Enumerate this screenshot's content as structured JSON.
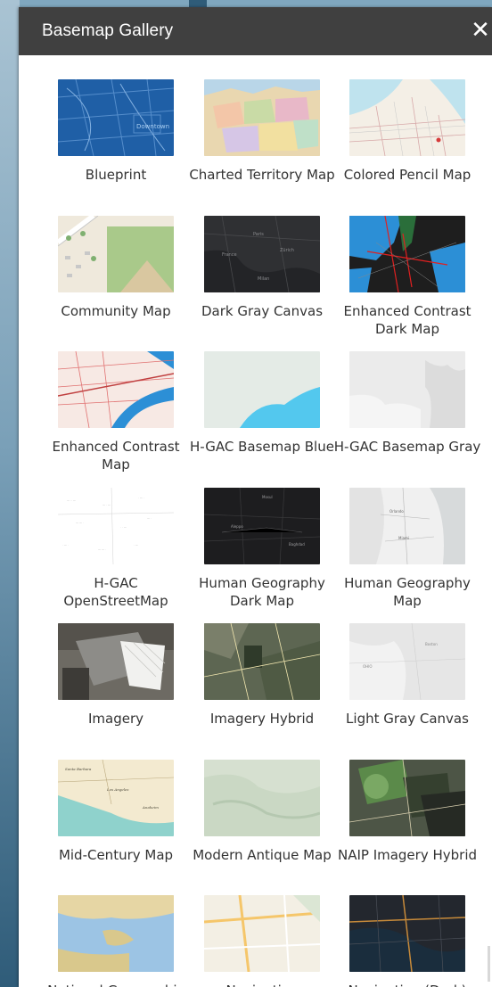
{
  "header": {
    "title": "Basemap Gallery",
    "close_symbol": "✕"
  },
  "items": [
    {
      "label": "Blueprint",
      "thumb": "blueprint"
    },
    {
      "label": "Charted Territory Map",
      "thumb": "charted"
    },
    {
      "label": "Colored Pencil Map",
      "thumb": "pencil"
    },
    {
      "label": "Community Map",
      "thumb": "community"
    },
    {
      "label": "Dark Gray Canvas",
      "thumb": "darkgray"
    },
    {
      "label": "Enhanced Contrast Dark Map",
      "thumb": "ecdark"
    },
    {
      "label": "Enhanced Contrast Map",
      "thumb": "ecmap"
    },
    {
      "label": "H-GAC Basemap Blue",
      "thumb": "hgacblue"
    },
    {
      "label": "H-GAC Basemap Gray",
      "thumb": "hgacgray"
    },
    {
      "label": "H-GAC OpenStreetMap Reference",
      "thumb": "hgacosm"
    },
    {
      "label": "Human Geography Dark Map",
      "thumb": "humandark"
    },
    {
      "label": "Human Geography Map",
      "thumb": "humanmap"
    },
    {
      "label": "Imagery",
      "thumb": "imagery"
    },
    {
      "label": "Imagery Hybrid",
      "thumb": "imageryhybrid"
    },
    {
      "label": "Light Gray Canvas",
      "thumb": "lightgray"
    },
    {
      "label": "Mid-Century Map",
      "thumb": "midcentury"
    },
    {
      "label": "Modern Antique Map",
      "thumb": "antique"
    },
    {
      "label": "NAIP Imagery Hybrid",
      "thumb": "naip"
    },
    {
      "label": "National Geographic Style Map",
      "thumb": "natgeo"
    },
    {
      "label": "Navigation",
      "thumb": "navigation"
    },
    {
      "label": "Navigation (Dark)",
      "thumb": "navdark"
    }
  ],
  "colors": {
    "header_bg": "#404040",
    "panel_bg": "#ffffff",
    "label_text": "#333333"
  }
}
